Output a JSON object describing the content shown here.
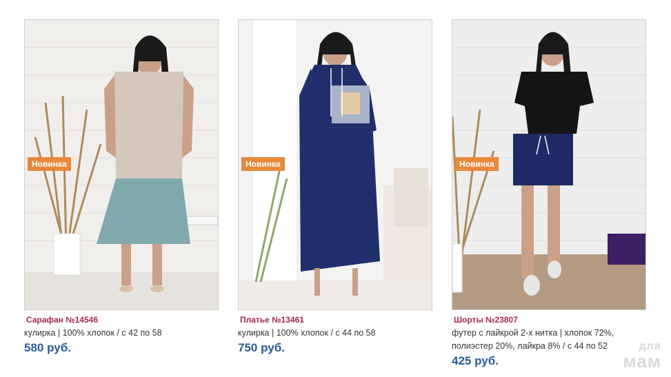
{
  "products": [
    {
      "badge": "Новинка",
      "title": "Сарафан №14546",
      "description": "кулирка | 100% хлопок / с 42 по 58",
      "price": "580 руб."
    },
    {
      "badge": "Новинка",
      "title": "Платье №13461",
      "description": "кулирка | 100% хлопок / с 44 по 58",
      "price": "750 руб."
    },
    {
      "badge": "Новинка",
      "title": "Шорты №23807",
      "description": "футер с лайкрой 2-х нитка | хлопок 72%, полиэстер 20%, лайкра 8% / с 44 по 52",
      "price": "425 руб."
    }
  ],
  "watermark": {
    "line1": "для",
    "line2": "мам"
  },
  "colors": {
    "badge": "#e8883a",
    "title": "#a3275c",
    "price": "#2a5a9c",
    "text": "#333333"
  }
}
